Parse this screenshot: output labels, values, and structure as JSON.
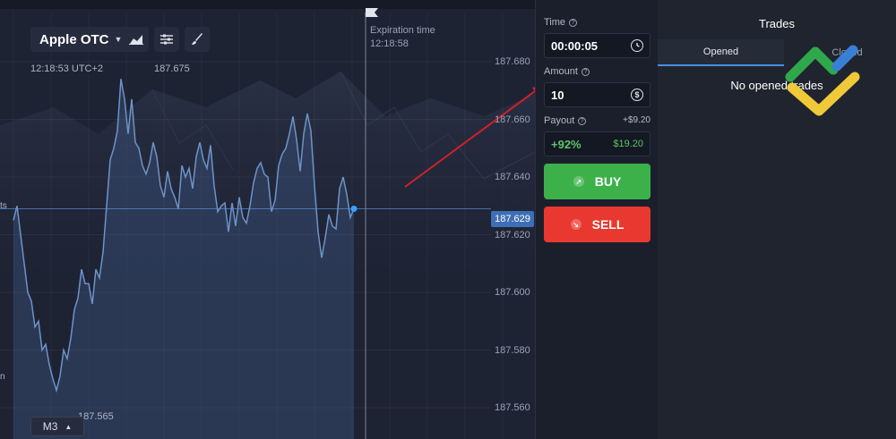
{
  "chart": {
    "asset": "Apple OTC",
    "clock": "12:18:53 UTC+2",
    "high_marker": "187.675",
    "low_marker": "187.565",
    "expiration_title": "Expiration time",
    "expiration_time": "12:18:58",
    "current_price": "187.629",
    "timeframe": "M3",
    "side_text_1": "ts",
    "side_text_2": "n",
    "price_levels": [
      "187.680",
      "187.660",
      "187.640",
      "187.620",
      "187.600",
      "187.580",
      "187.560"
    ]
  },
  "chart_data": {
    "type": "area",
    "xlabel": "",
    "ylabel": "",
    "ylim": [
      187.555,
      187.69
    ],
    "y_ticks": [
      187.68,
      187.66,
      187.64,
      187.62,
      187.6,
      187.58,
      187.56
    ],
    "x": [
      0,
      1,
      2,
      3,
      4,
      5,
      6,
      7,
      8,
      9,
      10,
      11,
      12,
      13,
      14,
      15,
      16,
      17,
      18,
      19,
      20,
      21,
      22,
      23,
      24,
      25,
      26,
      27,
      28,
      29,
      30,
      31,
      32,
      33,
      34,
      35,
      36,
      37,
      38,
      39,
      40,
      41,
      42,
      43,
      44,
      45,
      46,
      47,
      48,
      49,
      50,
      51,
      52,
      53,
      54,
      55,
      56,
      57,
      58,
      59,
      60,
      61,
      62,
      63,
      64,
      65,
      66,
      67,
      68,
      69,
      70,
      71,
      72,
      73,
      74,
      75,
      76,
      77,
      78,
      79,
      80,
      81,
      82,
      83,
      84,
      85,
      86,
      87,
      88,
      89,
      90,
      91,
      92,
      93,
      94,
      95
    ],
    "values": [
      187.625,
      187.63,
      187.62,
      187.61,
      187.6,
      187.597,
      187.588,
      187.59,
      187.58,
      187.582,
      187.575,
      187.57,
      187.566,
      187.571,
      187.58,
      187.577,
      187.584,
      187.594,
      187.598,
      187.608,
      187.603,
      187.603,
      187.596,
      187.608,
      187.605,
      187.614,
      187.63,
      187.646,
      187.65,
      187.656,
      187.674,
      187.667,
      187.655,
      187.667,
      187.652,
      187.65,
      187.644,
      187.641,
      187.645,
      187.652,
      187.647,
      187.637,
      187.633,
      187.642,
      187.636,
      187.633,
      187.629,
      187.644,
      187.64,
      187.643,
      187.636,
      187.647,
      187.652,
      187.646,
      187.643,
      187.651,
      187.637,
      187.628,
      187.63,
      187.631,
      187.621,
      187.631,
      187.623,
      187.633,
      187.626,
      187.624,
      187.63,
      187.638,
      187.643,
      187.645,
      187.641,
      187.64,
      187.628,
      187.632,
      187.644,
      187.648,
      187.65,
      187.655,
      187.661,
      187.653,
      187.642,
      187.655,
      187.662,
      187.656,
      187.637,
      187.621,
      187.612,
      187.619,
      187.627,
      187.623,
      187.622,
      187.636,
      187.64,
      187.634,
      187.626,
      187.629
    ],
    "grid": true,
    "legend": ""
  },
  "trade": {
    "time_label": "Time",
    "time_value": "00:00:05",
    "amount_label": "Amount",
    "amount_value": "10",
    "amount_icon": "dollar-icon",
    "payout_label": "Payout",
    "payout_extra": "+$9.20",
    "payout_pct": "+92%",
    "payout_amount": "$19.20",
    "buy_label": "BUY",
    "sell_label": "SELL"
  },
  "trades": {
    "title": "Trades",
    "tab_opened": "Opened",
    "tab_closed": "Closed",
    "empty_message": "No opened trades"
  },
  "colors": {
    "buy": "#3cb14a",
    "sell": "#e8382f",
    "payout": "#5fc36a",
    "line": "#6d93c8",
    "price_tag": "#3e6fb4",
    "annotation_arrow": "#d21f2b"
  }
}
